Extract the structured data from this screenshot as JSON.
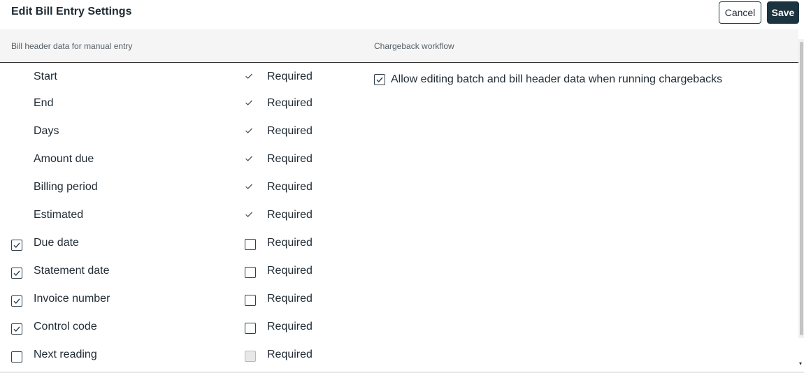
{
  "header": {
    "title": "Edit Bill Entry Settings",
    "cancel_label": "Cancel",
    "save_label": "Save"
  },
  "sections": {
    "left_label": "Bill header data for manual entry",
    "right_label": "Chargeback workflow"
  },
  "fields": [
    {
      "label": "Start",
      "enabled": "fixed",
      "required": "fixed",
      "required_label": "Required"
    },
    {
      "label": "End",
      "enabled": "fixed",
      "required": "fixed",
      "required_label": "Required"
    },
    {
      "label": "Days",
      "enabled": "fixed",
      "required": "fixed",
      "required_label": "Required"
    },
    {
      "label": "Amount due",
      "enabled": "fixed",
      "required": "fixed",
      "required_label": "Required"
    },
    {
      "label": "Billing period",
      "enabled": "fixed",
      "required": "fixed",
      "required_label": "Required"
    },
    {
      "label": "Estimated",
      "enabled": "fixed",
      "required": "fixed",
      "required_label": "Required"
    },
    {
      "label": "Due date",
      "enabled": "checked",
      "required": "unchecked",
      "required_label": "Required"
    },
    {
      "label": "Statement date",
      "enabled": "checked",
      "required": "unchecked",
      "required_label": "Required"
    },
    {
      "label": "Invoice number",
      "enabled": "checked",
      "required": "unchecked",
      "required_label": "Required"
    },
    {
      "label": "Control code",
      "enabled": "checked",
      "required": "unchecked",
      "required_label": "Required"
    },
    {
      "label": "Next reading",
      "enabled": "unchecked",
      "required": "disabled",
      "required_label": "Required"
    }
  ],
  "chargeback": {
    "label": "Allow editing batch and bill header data when running chargebacks",
    "checked": true
  },
  "colors": {
    "primary": "#1c3340",
    "section_bg": "#f5f5f5",
    "text": "#1f2a33",
    "muted": "#555f66"
  }
}
